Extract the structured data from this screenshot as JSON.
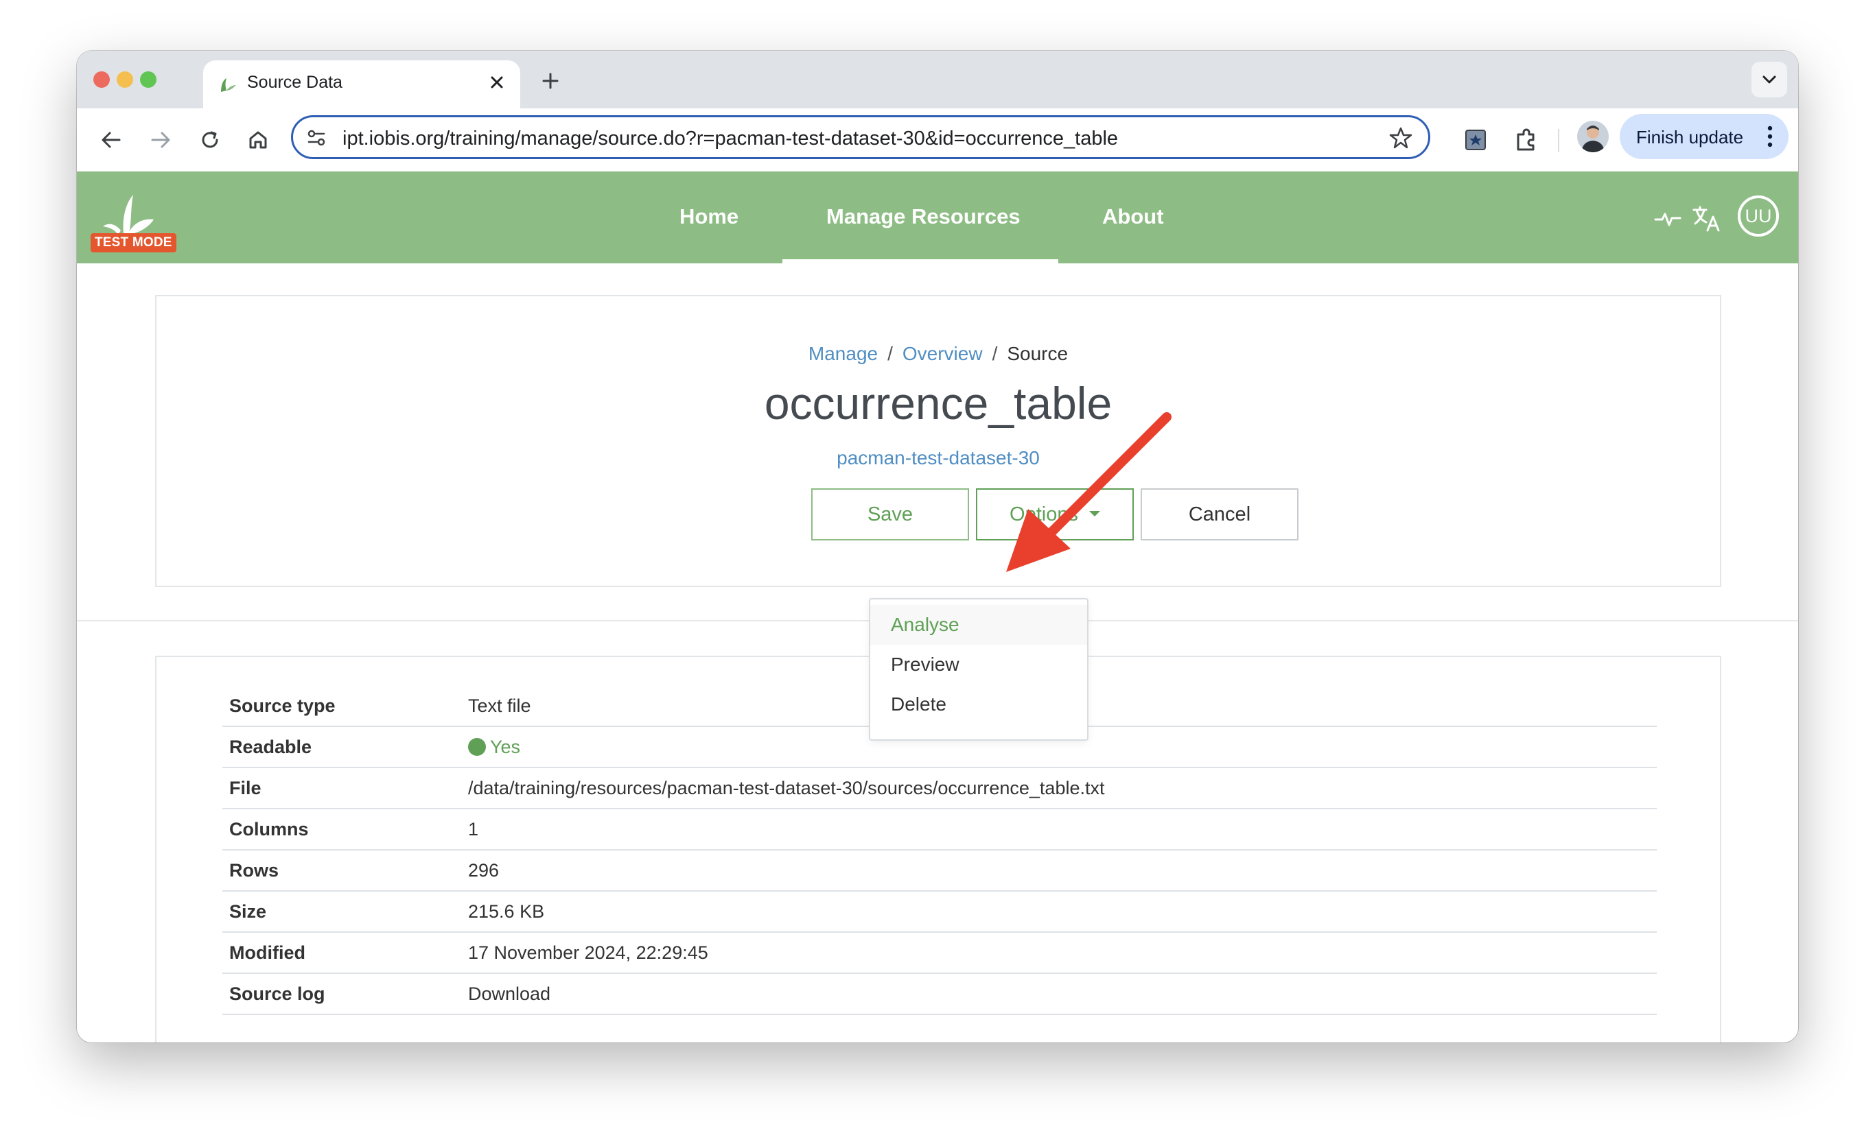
{
  "browser": {
    "tab_title": "Source Data",
    "url": "ipt.iobis.org/training/manage/source.do?r=pacman-test-dataset-30&id=occurrence_table",
    "finish_update_label": "Finish update"
  },
  "navbar": {
    "test_mode_label": "TEST MODE",
    "links": [
      "Home",
      "Manage Resources",
      "About"
    ],
    "active_link": "Manage Resources",
    "user_initials": "UU",
    "brand_color": "#8dbd84"
  },
  "header": {
    "breadcrumb": [
      "Manage",
      "Overview",
      "Source"
    ],
    "title": "occurrence_table",
    "resource": "pacman-test-dataset-30",
    "buttons": {
      "save": "Save",
      "options": "Options",
      "cancel": "Cancel"
    }
  },
  "options_menu": {
    "items": [
      "Analyse",
      "Preview",
      "Delete"
    ],
    "highlighted": "Analyse"
  },
  "details": {
    "rows": [
      {
        "label": "Source type",
        "value": "Text file"
      },
      {
        "label": "Readable",
        "value": "Yes"
      },
      {
        "label": "File",
        "value": "/data/training/resources/pacman-test-dataset-30/sources/occurrence_table.txt"
      },
      {
        "label": "Columns",
        "value": "1"
      },
      {
        "label": "Rows",
        "value": "296"
      },
      {
        "label": "Size",
        "value": "215.6 KB"
      },
      {
        "label": "Modified",
        "value": "17 November 2024, 22:29:45"
      },
      {
        "label": "Source log",
        "value": "Download"
      }
    ]
  },
  "colors": {
    "accent_green": "#5fa056",
    "link_blue": "#4f8ec3",
    "annotation_arrow": "#e8402c",
    "test_mode_badge": "#e4572e"
  }
}
